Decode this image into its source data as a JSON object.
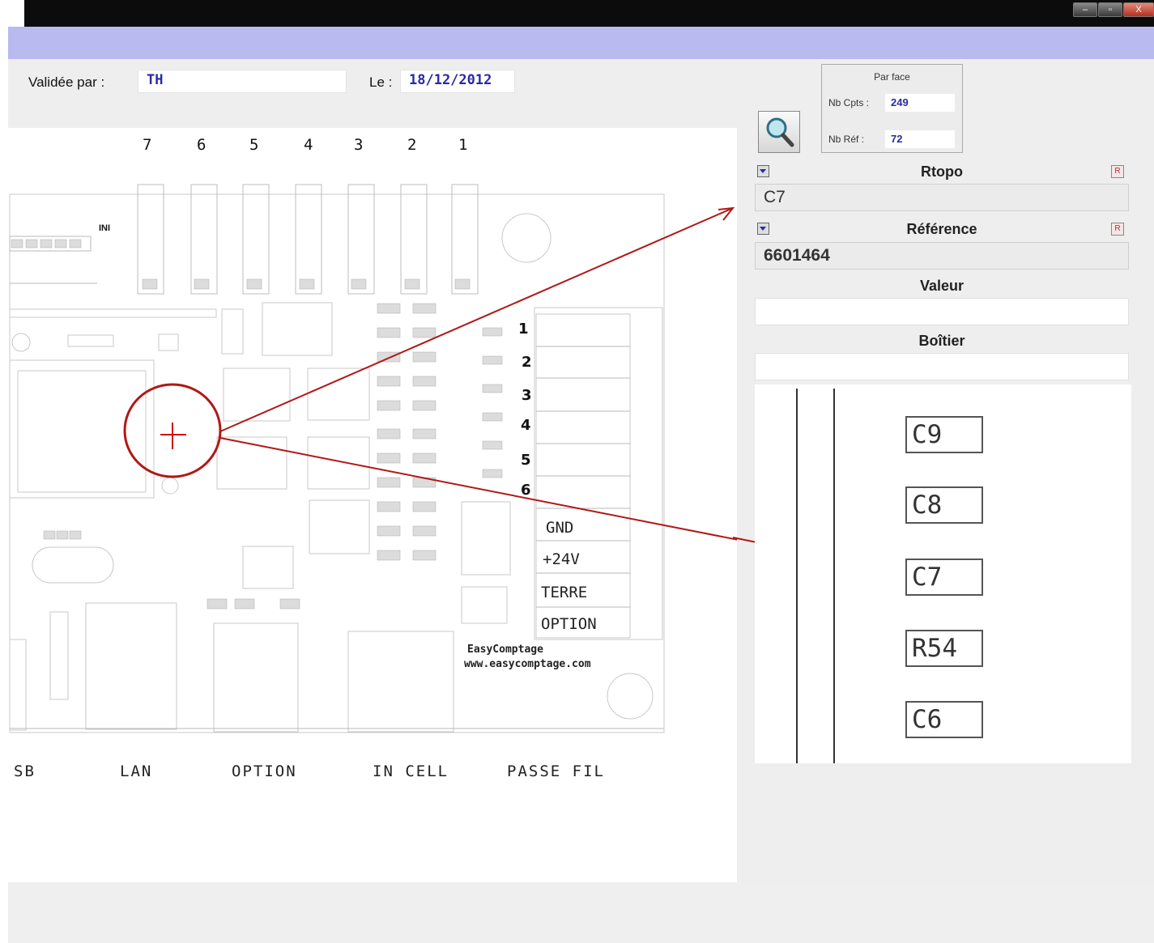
{
  "window": {
    "buttons": [
      "–",
      "▫",
      "X"
    ]
  },
  "validation": {
    "validated_by_label": "Validée par :",
    "validated_by_value": "TH",
    "date_label": "Le :",
    "date_value": "18/12/2012"
  },
  "stats": {
    "title": "Par face",
    "nb_cpts_label": "Nb Cpts :",
    "nb_cpts_value": "249",
    "nb_ref_label": "Nb Réf :",
    "nb_ref_value": "72"
  },
  "rtopo": {
    "title": "Rtopo",
    "value": "C7"
  },
  "reference": {
    "title": "Référence",
    "value": "6601464"
  },
  "valeur": {
    "title": "Valeur",
    "value": ""
  },
  "boitier": {
    "title": "Boîtier",
    "value": ""
  },
  "preview": {
    "components": [
      "C9",
      "C8",
      "C7",
      "R54",
      "C6"
    ]
  },
  "board": {
    "top_numbers": [
      "7",
      "6",
      "5",
      "4",
      "3",
      "2",
      "1"
    ],
    "header_label": "INI",
    "terminal_numbers": [
      "1",
      "2",
      "3",
      "4",
      "5",
      "6"
    ],
    "terminal_labels": [
      "GND",
      "+24V",
      "TERRE",
      "OPTION"
    ],
    "brand": "EasyComptage",
    "website": "www.easycomptage.com",
    "connectors": [
      "SB",
      "LAN",
      "OPTION",
      "IN CELL",
      "PASSE FIL"
    ]
  },
  "colors": {
    "accent": "#b8baf0",
    "annotation": "#b01818",
    "value_text": "#2a2aa6"
  },
  "icons": [
    "magnifier-icon",
    "dropdown-icon",
    "reset-icon",
    "crosshair-icon"
  ]
}
